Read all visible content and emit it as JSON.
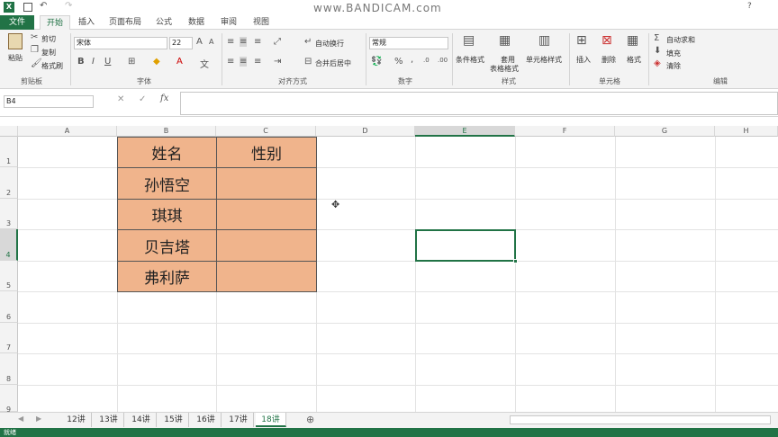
{
  "titlebar": {
    "watermark": "www.BANDICAM.com",
    "help": "?"
  },
  "tabs": [
    "文件",
    "开始",
    "插入",
    "页面布局",
    "公式",
    "数据",
    "审阅",
    "视图"
  ],
  "ribbon": {
    "clipboard": {
      "paste": "粘贴",
      "cut": "剪切",
      "copy": "复制",
      "format_painter": "格式刷",
      "label": "剪贴板"
    },
    "font": {
      "name": "宋体",
      "size": "22",
      "bold": "B",
      "italic": "I",
      "underline": "U",
      "label": "字体"
    },
    "alignment": {
      "wrap": "自动换行",
      "merge": "合并后居中",
      "label": "对齐方式"
    },
    "number": {
      "format": "常规",
      "percent": "%",
      "comma": ",",
      "label": "数字"
    },
    "styles": {
      "conditional": "条件格式",
      "table_a": "套用",
      "table_b": "表格格式",
      "cell_styles": "单元格样式",
      "label": "样式"
    },
    "cells": {
      "insert": "插入",
      "delete": "删除",
      "format": "格式",
      "label": "单元格"
    },
    "editing": {
      "autosum": "自动求和",
      "fill": "填充",
      "clear": "清除",
      "label": "编辑"
    }
  },
  "formula_bar": {
    "name_box": "B4",
    "fx": "fx",
    "value": ""
  },
  "columns": [
    "A",
    "B",
    "C",
    "D",
    "E",
    "F",
    "G",
    "H"
  ],
  "rows": [
    "1",
    "2",
    "3",
    "4",
    "5",
    "6",
    "7",
    "8",
    "9"
  ],
  "table": {
    "header": [
      "姓名",
      "性别"
    ],
    "names": [
      "孙悟空",
      "琪琪",
      "贝吉塔",
      "弗利萨"
    ]
  },
  "sheets": [
    "12讲",
    "13讲",
    "14讲",
    "15讲",
    "16讲",
    "17讲",
    "18讲"
  ],
  "active_sheet": "18讲",
  "status": "就绪",
  "colors": {
    "accent": "#217346",
    "cell_fill": "#f0b48c"
  }
}
